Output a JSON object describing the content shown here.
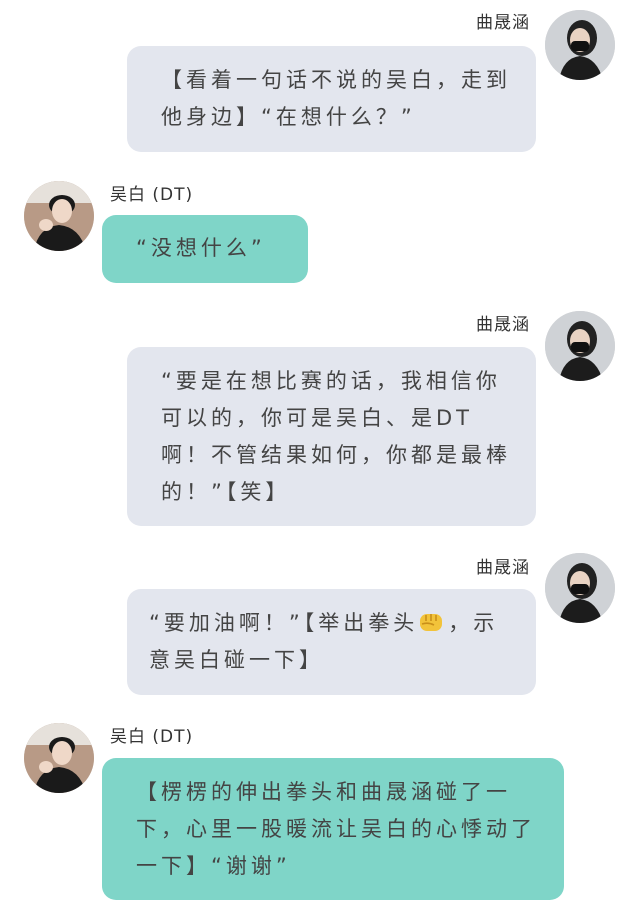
{
  "messages": [
    {
      "side": "right",
      "sender": "曲晟涵",
      "text": "【看着一句话不说的吴白，走到他身边】“在想什么？”",
      "bubble_color": "#e3e6ee"
    },
    {
      "side": "left",
      "sender": "吴白 (DT)",
      "text": "“没想什么”",
      "bubble_color": "#7fd5c8"
    },
    {
      "side": "right",
      "sender": "曲晟涵",
      "text": "“要是在想比赛的话，我相信你可以的，你可是吴白、是DT啊！不管结果如何，你都是最棒的！”【笑】",
      "bubble_color": "#e3e6ee"
    },
    {
      "side": "right",
      "sender": "曲晟涵",
      "text_before_icon": "“要加油啊！”【举出拳头",
      "icon": "fist-emoji",
      "text_after_icon": "，示意吴白碰一下】",
      "bubble_color": "#e3e6ee"
    },
    {
      "side": "left",
      "sender": "吴白 (DT)",
      "text": "【楞楞的伸出拳头和曲晟涵碰了一下，心里一股暖流让吴白的心悸动了一下】“谢谢”",
      "bubble_color": "#7fd5c8"
    }
  ]
}
